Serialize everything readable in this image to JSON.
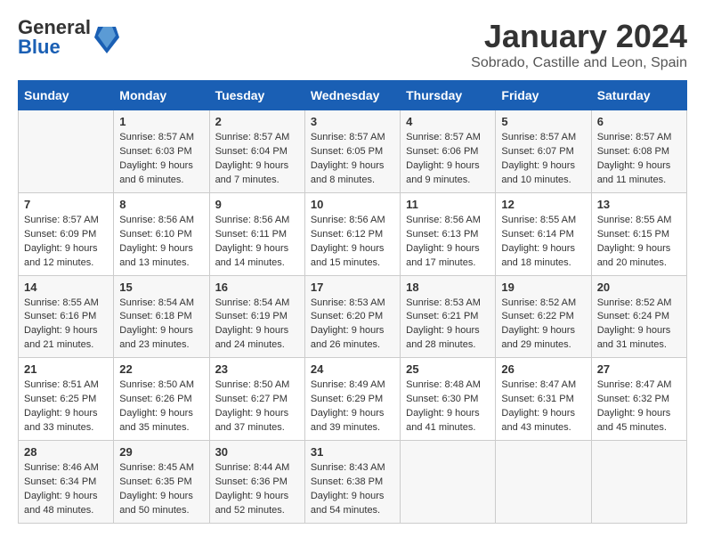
{
  "header": {
    "logo_line1": "General",
    "logo_line2": "Blue",
    "month": "January 2024",
    "location": "Sobrado, Castille and Leon, Spain"
  },
  "weekdays": [
    "Sunday",
    "Monday",
    "Tuesday",
    "Wednesday",
    "Thursday",
    "Friday",
    "Saturday"
  ],
  "weeks": [
    [
      {
        "day": "",
        "content": ""
      },
      {
        "day": "1",
        "content": "Sunrise: 8:57 AM\nSunset: 6:03 PM\nDaylight: 9 hours\nand 6 minutes."
      },
      {
        "day": "2",
        "content": "Sunrise: 8:57 AM\nSunset: 6:04 PM\nDaylight: 9 hours\nand 7 minutes."
      },
      {
        "day": "3",
        "content": "Sunrise: 8:57 AM\nSunset: 6:05 PM\nDaylight: 9 hours\nand 8 minutes."
      },
      {
        "day": "4",
        "content": "Sunrise: 8:57 AM\nSunset: 6:06 PM\nDaylight: 9 hours\nand 9 minutes."
      },
      {
        "day": "5",
        "content": "Sunrise: 8:57 AM\nSunset: 6:07 PM\nDaylight: 9 hours\nand 10 minutes."
      },
      {
        "day": "6",
        "content": "Sunrise: 8:57 AM\nSunset: 6:08 PM\nDaylight: 9 hours\nand 11 minutes."
      }
    ],
    [
      {
        "day": "7",
        "content": "Sunrise: 8:57 AM\nSunset: 6:09 PM\nDaylight: 9 hours\nand 12 minutes."
      },
      {
        "day": "8",
        "content": "Sunrise: 8:56 AM\nSunset: 6:10 PM\nDaylight: 9 hours\nand 13 minutes."
      },
      {
        "day": "9",
        "content": "Sunrise: 8:56 AM\nSunset: 6:11 PM\nDaylight: 9 hours\nand 14 minutes."
      },
      {
        "day": "10",
        "content": "Sunrise: 8:56 AM\nSunset: 6:12 PM\nDaylight: 9 hours\nand 15 minutes."
      },
      {
        "day": "11",
        "content": "Sunrise: 8:56 AM\nSunset: 6:13 PM\nDaylight: 9 hours\nand 17 minutes."
      },
      {
        "day": "12",
        "content": "Sunrise: 8:55 AM\nSunset: 6:14 PM\nDaylight: 9 hours\nand 18 minutes."
      },
      {
        "day": "13",
        "content": "Sunrise: 8:55 AM\nSunset: 6:15 PM\nDaylight: 9 hours\nand 20 minutes."
      }
    ],
    [
      {
        "day": "14",
        "content": "Sunrise: 8:55 AM\nSunset: 6:16 PM\nDaylight: 9 hours\nand 21 minutes."
      },
      {
        "day": "15",
        "content": "Sunrise: 8:54 AM\nSunset: 6:18 PM\nDaylight: 9 hours\nand 23 minutes."
      },
      {
        "day": "16",
        "content": "Sunrise: 8:54 AM\nSunset: 6:19 PM\nDaylight: 9 hours\nand 24 minutes."
      },
      {
        "day": "17",
        "content": "Sunrise: 8:53 AM\nSunset: 6:20 PM\nDaylight: 9 hours\nand 26 minutes."
      },
      {
        "day": "18",
        "content": "Sunrise: 8:53 AM\nSunset: 6:21 PM\nDaylight: 9 hours\nand 28 minutes."
      },
      {
        "day": "19",
        "content": "Sunrise: 8:52 AM\nSunset: 6:22 PM\nDaylight: 9 hours\nand 29 minutes."
      },
      {
        "day": "20",
        "content": "Sunrise: 8:52 AM\nSunset: 6:24 PM\nDaylight: 9 hours\nand 31 minutes."
      }
    ],
    [
      {
        "day": "21",
        "content": "Sunrise: 8:51 AM\nSunset: 6:25 PM\nDaylight: 9 hours\nand 33 minutes."
      },
      {
        "day": "22",
        "content": "Sunrise: 8:50 AM\nSunset: 6:26 PM\nDaylight: 9 hours\nand 35 minutes."
      },
      {
        "day": "23",
        "content": "Sunrise: 8:50 AM\nSunset: 6:27 PM\nDaylight: 9 hours\nand 37 minutes."
      },
      {
        "day": "24",
        "content": "Sunrise: 8:49 AM\nSunset: 6:29 PM\nDaylight: 9 hours\nand 39 minutes."
      },
      {
        "day": "25",
        "content": "Sunrise: 8:48 AM\nSunset: 6:30 PM\nDaylight: 9 hours\nand 41 minutes."
      },
      {
        "day": "26",
        "content": "Sunrise: 8:47 AM\nSunset: 6:31 PM\nDaylight: 9 hours\nand 43 minutes."
      },
      {
        "day": "27",
        "content": "Sunrise: 8:47 AM\nSunset: 6:32 PM\nDaylight: 9 hours\nand 45 minutes."
      }
    ],
    [
      {
        "day": "28",
        "content": "Sunrise: 8:46 AM\nSunset: 6:34 PM\nDaylight: 9 hours\nand 48 minutes."
      },
      {
        "day": "29",
        "content": "Sunrise: 8:45 AM\nSunset: 6:35 PM\nDaylight: 9 hours\nand 50 minutes."
      },
      {
        "day": "30",
        "content": "Sunrise: 8:44 AM\nSunset: 6:36 PM\nDaylight: 9 hours\nand 52 minutes."
      },
      {
        "day": "31",
        "content": "Sunrise: 8:43 AM\nSunset: 6:38 PM\nDaylight: 9 hours\nand 54 minutes."
      },
      {
        "day": "",
        "content": ""
      },
      {
        "day": "",
        "content": ""
      },
      {
        "day": "",
        "content": ""
      }
    ]
  ]
}
